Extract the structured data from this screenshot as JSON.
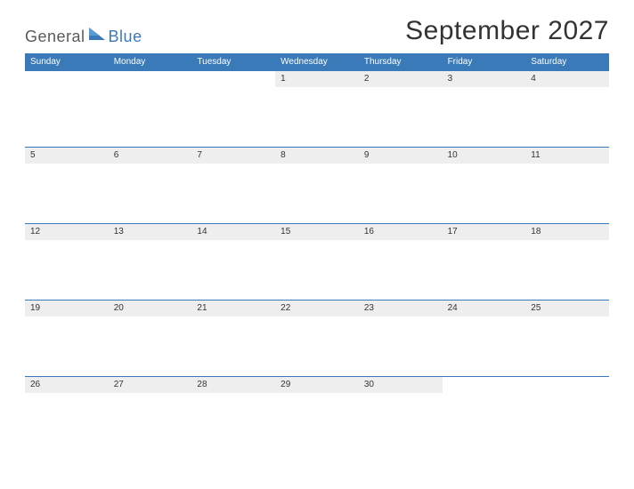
{
  "logo": {
    "word1": "General",
    "word2": "Blue"
  },
  "title": "September 2027",
  "dayNames": [
    "Sunday",
    "Monday",
    "Tuesday",
    "Wednesday",
    "Thursday",
    "Friday",
    "Saturday"
  ],
  "weeks": [
    [
      "",
      "",
      "",
      "1",
      "2",
      "3",
      "4"
    ],
    [
      "5",
      "6",
      "7",
      "8",
      "9",
      "10",
      "11"
    ],
    [
      "12",
      "13",
      "14",
      "15",
      "16",
      "17",
      "18"
    ],
    [
      "19",
      "20",
      "21",
      "22",
      "23",
      "24",
      "25"
    ],
    [
      "26",
      "27",
      "28",
      "29",
      "30",
      "",
      ""
    ]
  ]
}
